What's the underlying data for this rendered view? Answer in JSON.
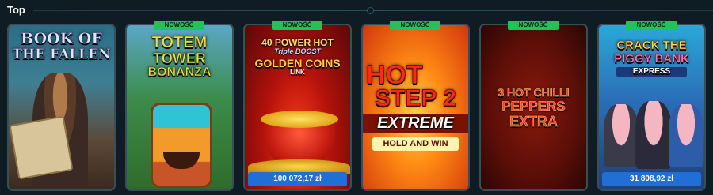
{
  "section": {
    "title": "Top"
  },
  "badge_label": "NOWOŚĆ",
  "games": [
    {
      "title_line1": "BOOK OF",
      "title_line2": "THE FALLEN",
      "is_new": false,
      "jackpot": ""
    },
    {
      "title_line1": "TOTEM",
      "title_line2": "TOWER",
      "title_line3": "BONANZA",
      "is_new": true,
      "jackpot": ""
    },
    {
      "title_line1": "40 POWER HOT",
      "title_line2": "Triple BOOST",
      "title_line3": "GOLDEN COINS",
      "title_line4": "LINK",
      "is_new": true,
      "jackpot": "100 072,17 zł"
    },
    {
      "title_line1": "HOT",
      "title_line2": "STEP 2",
      "title_line3": "EXTREME",
      "title_line4": "HOLD AND WIN",
      "is_new": true,
      "jackpot": ""
    },
    {
      "title_line1": "3 HOT CHILLI",
      "title_line2": "PEPPERS",
      "title_line3": "EXTRA",
      "is_new": true,
      "jackpot": ""
    },
    {
      "title_line1": "CRACK THE",
      "title_line2": "PIGGY BANK",
      "title_line3": "EXPRESS",
      "is_new": true,
      "jackpot": "31 808,92 zł"
    }
  ],
  "colors": {
    "background": "#0f1c23",
    "badge": "#21c25a",
    "jackpot": "#1f6fd6",
    "card_border": "#3a4e57"
  }
}
